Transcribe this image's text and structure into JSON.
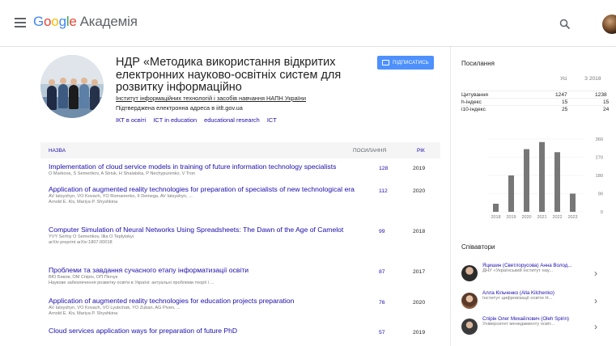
{
  "header": {
    "logo_google": [
      "G",
      "o",
      "o",
      "g",
      "l",
      "e"
    ],
    "product": "Академія"
  },
  "profile": {
    "name": "НДР «Методика використання відкритих електронних науково-освітніх систем для розвитку інформаційно",
    "affiliation": "Інститут інформаційних технологій і засобів навчання НАПН України",
    "verified": "Підтверджена електронна адреса в iitlt.gov.ua",
    "interests": [
      "ІКТ в освіті",
      "ICT in education",
      "educational research",
      "ICT"
    ],
    "follow_label": "ПІДПИСАТИСЬ"
  },
  "table": {
    "col_title": "НАЗВА",
    "col_cites": "ПОСИЛАННЯ",
    "col_year": "РІК",
    "rows": [
      {
        "title": "Implementation of cloud service models in training of future information technology specialists",
        "authors": "O Markova, S Semerikov, A Striuk, H Shalatska, P Nechypurenko, V Tron",
        "venue": "",
        "cites": "128",
        "year": "2019"
      },
      {
        "title": "Application of augmented reality technologies for preparation of specialists of new technological era",
        "authors": "AV Iatsyshyn, VO Kovach, YO Romanenko, II Deinega, AV Iatsyshyn, ...",
        "venue": "Arnold E. Kiv, Mariya P. Shyshkina",
        "cites": "112",
        "year": "2020"
      },
      {
        "title": "Computer Simulation of Neural Networks Using Spreadsheets: The Dawn of the Age of Camelot",
        "authors": "YVY Serhiy O Semerikov, Illia O Teplytskyi",
        "venue": "arXiv preprint arXiv:1807.00018",
        "cites": "99",
        "year": "2018"
      },
      {
        "title": "Проблеми та завдання сучасного етапу інформатизації освіти",
        "authors": "ВЮ Биков, ОМ Спірін, ОП Пінчук",
        "venue": "Наукове забезпечення розвитку освіти в Україні: актуальні проблеми теорії і ...",
        "cites": "87",
        "year": "2017"
      },
      {
        "title": "Application of augmented reality technologies for education projects preparation",
        "authors": "AV Iatsyshyn, VO Kovach, VO Lyubchak, YO Zuban, AG Piven, ...",
        "venue": "Arnold E. Kiv, Mariya P. Shyshkina",
        "cites": "76",
        "year": "2020"
      },
      {
        "title": "Cloud services application ways for preparation of future PhD",
        "authors": "",
        "venue": "",
        "cites": "57",
        "year": "2019"
      }
    ]
  },
  "metrics": {
    "title": "Посилання",
    "col_all": "Усі",
    "col_since": "З 2018",
    "rows": [
      {
        "label": "Цитування",
        "all": "1247",
        "since": "1238"
      },
      {
        "label": "h-індекс",
        "all": "15",
        "since": "15"
      },
      {
        "label": "i10-індекс",
        "all": "25",
        "since": "24"
      }
    ]
  },
  "chart_data": {
    "type": "bar",
    "categories": [
      "2018",
      "2019",
      "2020",
      "2021",
      "2022",
      "2023"
    ],
    "values": [
      40,
      180,
      310,
      345,
      295,
      90
    ],
    "yticks": [
      "360",
      "270",
      "180",
      "90",
      "0"
    ],
    "ylim": [
      0,
      360
    ],
    "color": "#777777"
  },
  "coauthors": {
    "title": "Співавтори",
    "items": [
      {
        "name": "Яцишин (Светлорусова) Анна Волод...",
        "org": "ДНУ «Український інститут нау..."
      },
      {
        "name": "Алла Кільченко (Alla Kilchenko)",
        "org": "Інститут цифровізації освіти Н..."
      },
      {
        "name": "Спірін Олег Михайлович (Oleh Spirin)",
        "org": "Університет менеджменту освіт..."
      }
    ]
  }
}
